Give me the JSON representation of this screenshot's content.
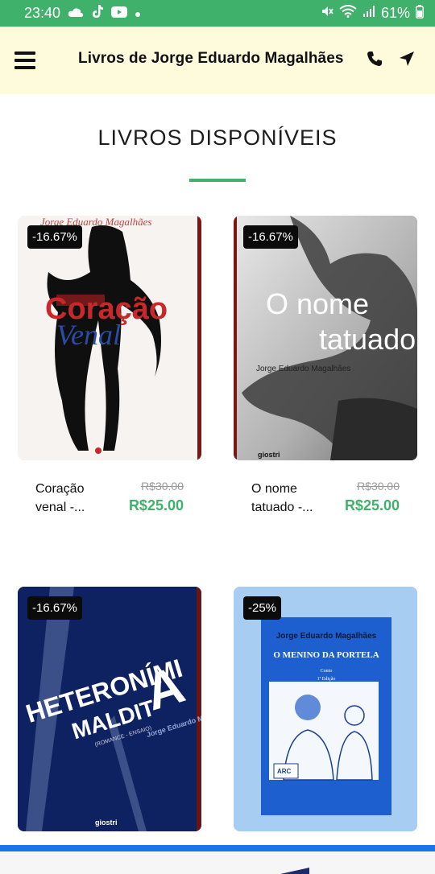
{
  "status_bar": {
    "time": "23:40",
    "battery": "61%"
  },
  "header": {
    "title": "Livros de Jorge Eduardo Magalhães"
  },
  "section": {
    "title": "LIVROS DISPONÍVEIS"
  },
  "products": [
    {
      "discount": "-16.67%",
      "name": "Coração venal -...",
      "old_price": "R$30.00",
      "price": "R$25.00",
      "cover": {
        "author": "Jorge Eduardo Magalhães",
        "title_line1": "Coração",
        "title_line2": "Venal"
      }
    },
    {
      "discount": "-16.67%",
      "name": "O nome tatuado -...",
      "old_price": "R$30.00",
      "price": "R$25.00",
      "cover": {
        "title_line1": "O nome",
        "title_line2": "tatuado",
        "author": "Jorge Eduardo Magalhães",
        "publisher": "giostri"
      }
    },
    {
      "discount": "-16.67%",
      "cover": {
        "title_line1": "HETERONÍMI",
        "title_line2": "MALDIT",
        "big_letter": "A",
        "author": "Jorge Eduardo Magalhães",
        "subtitle": "(ROMANCE - ENSAIO)",
        "publisher": "giostri"
      }
    },
    {
      "discount": "-25%",
      "cover": {
        "author": "Jorge Eduardo Magalhães",
        "title": "O MENINO DA PORTELA",
        "genre": "Conto",
        "edition": "1ª Edição",
        "publisher": "ARC"
      }
    }
  ],
  "colors": {
    "accent": "#3fb16a",
    "header_bg": "#fdfbdc",
    "bottom_line": "#1a73e8"
  }
}
